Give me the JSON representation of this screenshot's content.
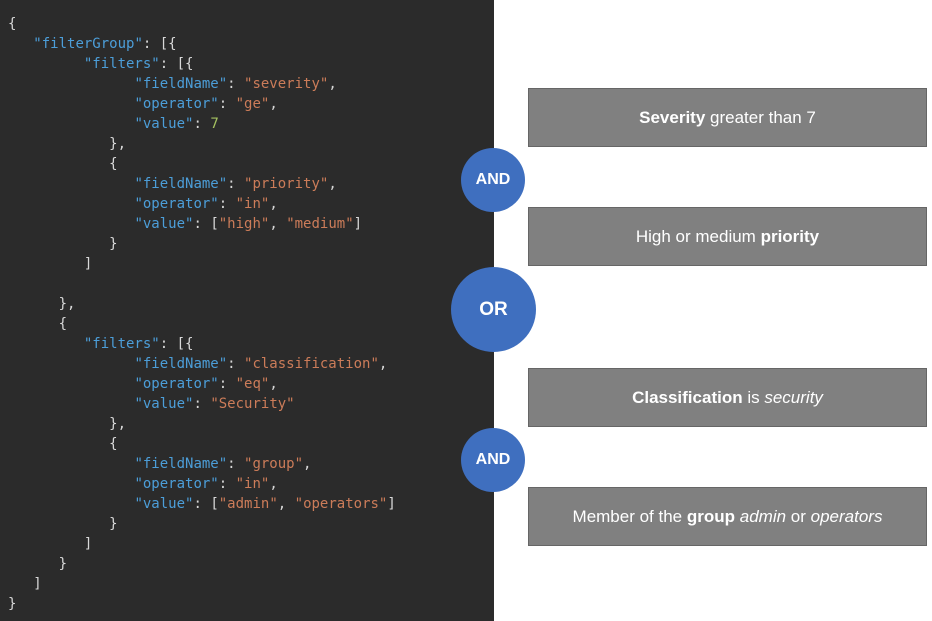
{
  "code": {
    "punct": {
      "obrace": "{",
      "cbrace": "}",
      "obracket": "[",
      "cbracket": "]",
      "comma": ",",
      "colon": ": "
    },
    "keys": {
      "filterGroup": "\"filterGroup\"",
      "filters": "\"filters\"",
      "fieldName": "\"fieldName\"",
      "operator": "\"operator\"",
      "value": "\"value\""
    },
    "str": {
      "severity": "\"severity\"",
      "ge": "\"ge\"",
      "priority": "\"priority\"",
      "in": "\"in\"",
      "high": "\"high\"",
      "medium": "\"medium\"",
      "classification": "\"classification\"",
      "eq": "\"eq\"",
      "Security": "\"Security\"",
      "group": "\"group\"",
      "admin": "\"admin\"",
      "operators": "\"operators\""
    },
    "num": {
      "seven": "7"
    }
  },
  "descriptions": [
    {
      "segments": [
        {
          "style": "bold",
          "text": "Severity"
        },
        {
          "style": "plain",
          "text": " greater than 7"
        }
      ]
    },
    {
      "segments": [
        {
          "style": "plain",
          "text": "High or medium "
        },
        {
          "style": "bold",
          "text": "priority"
        }
      ]
    },
    {
      "segments": [
        {
          "style": "bold",
          "text": "Classification"
        },
        {
          "style": "plain",
          "text": " is "
        },
        {
          "style": "italic",
          "text": "security"
        }
      ]
    },
    {
      "segments": [
        {
          "style": "plain",
          "text": "Member of the "
        },
        {
          "style": "bold",
          "text": "group"
        },
        {
          "style": "plain",
          "text": " "
        },
        {
          "style": "italic",
          "text": "admin"
        },
        {
          "style": "plain",
          "text": " or "
        },
        {
          "style": "italic",
          "text": "operators"
        }
      ]
    }
  ],
  "badges": {
    "and0": "AND",
    "or0": "OR",
    "and1": "AND"
  }
}
